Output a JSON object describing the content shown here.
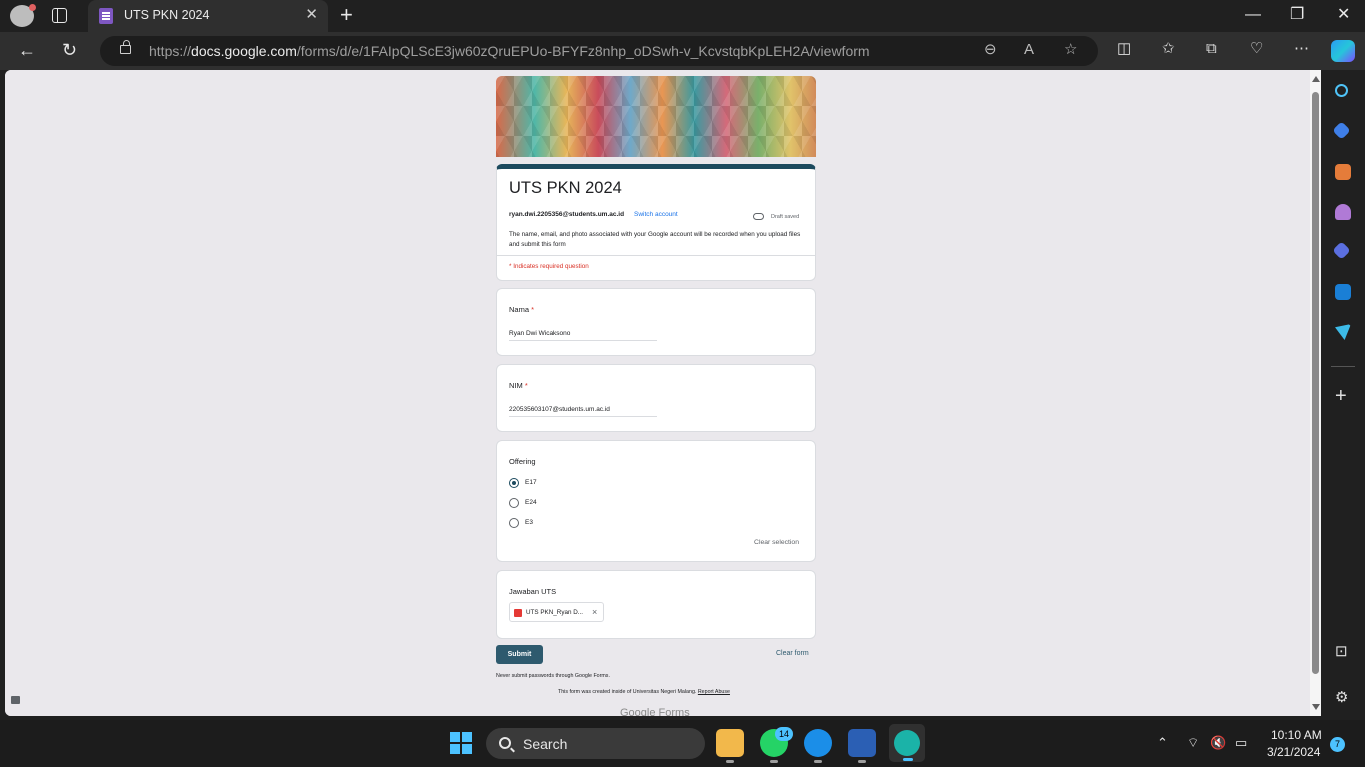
{
  "browser": {
    "tab_title": "UTS PKN 2024",
    "tab_close": "✕",
    "new_tab": "+",
    "url_prefix": "https://",
    "url_host": "docs.google.com",
    "url_path": "/forms/d/e/1FAIpQLScE3jw60zQruEPUo-BFYFz8nhp_oDSwh-v_KcvstqbKpLEH2A/viewform",
    "icons": [
      "back-icon",
      "refresh-icon",
      "zoom-out-icon",
      "read-aloud-icon",
      "favorite-icon",
      "split-screen-icon",
      "favorites-icon",
      "collections-icon",
      "performance-icon",
      "more-icon",
      "copilot-icon"
    ]
  },
  "form": {
    "title": "UTS PKN 2024",
    "account_email": "ryan.dwi.2205356@students.um.ac.id",
    "switch_account": "Switch account",
    "draft_status": "Draft saved",
    "notice": "The name, email, and photo associated with your Google account will be recorded when you upload files and submit this form",
    "required_note": "* Indicates required question",
    "questions": [
      {
        "label": "Nama",
        "required": true,
        "value": "Ryan Dwi Wicaksono"
      },
      {
        "label": "NIM",
        "required": true,
        "value": "220535603107@students.um.ac.id"
      }
    ],
    "offering": {
      "label": "Offering",
      "options": [
        "E17",
        "E24",
        "E3"
      ],
      "selected": "E17",
      "clear_selection": "Clear selection"
    },
    "upload": {
      "label": "Jawaban UTS",
      "file_name": "UTS PKN_Ryan D...",
      "remove": "×"
    },
    "submit_label": "Submit",
    "clear_form_label": "Clear form",
    "never_submit": "Never submit passwords through Google Forms.",
    "created_inside": "This form was created inside of Universitas Negeri Malang.",
    "report_abuse": "Report Abuse",
    "footer_brand": "Google Forms",
    "required_star": "*",
    "theme_color": "#1c4a5e"
  },
  "taskbar": {
    "search_label": "Search",
    "whatsapp_badge": "14",
    "time": "10:10 AM",
    "date": "3/21/2024",
    "notification_count": "7"
  }
}
